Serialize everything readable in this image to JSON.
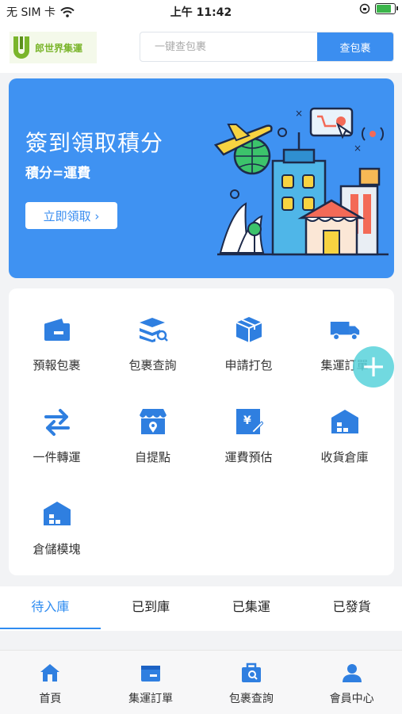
{
  "status": {
    "carrier": "无 SIM 卡",
    "time": "上午 11:42"
  },
  "header": {
    "logo_text": "郎世界集運",
    "search_placeholder": "一键查包裹",
    "search_button": "查包裹"
  },
  "banner": {
    "title": "簽到領取積分",
    "subtitle": "積分=運費",
    "cta": "立即領取 ›"
  },
  "services": [
    {
      "label": "預報包裹",
      "icon": "wallet-icon"
    },
    {
      "label": "包裹查詢",
      "icon": "stack-search-icon"
    },
    {
      "label": "申請打包",
      "icon": "box-icon"
    },
    {
      "label": "集運訂單",
      "icon": "truck-icon"
    },
    {
      "label": "一件轉運",
      "icon": "transfer-arrows-icon"
    },
    {
      "label": "自提點",
      "icon": "store-pin-icon"
    },
    {
      "label": "運費預估",
      "icon": "price-calc-icon"
    },
    {
      "label": "收貨倉庫",
      "icon": "warehouse-icon"
    },
    {
      "label": "倉儲模塊",
      "icon": "storage-icon"
    }
  ],
  "fab": {
    "icon": "plus-icon"
  },
  "tabs": [
    "待入庫",
    "已到庫",
    "已集運",
    "已發貨"
  ],
  "active_tab": "待入庫",
  "bottom_nav": [
    {
      "label": "首頁",
      "icon": "home-icon"
    },
    {
      "label": "集運訂單",
      "icon": "order-icon"
    },
    {
      "label": "包裹查詢",
      "icon": "parcel-search-icon"
    },
    {
      "label": "會員中心",
      "icon": "user-icon"
    }
  ],
  "colors": {
    "primary": "#3b8ef0",
    "banner": "#3f92f2",
    "fab": "#58d2da"
  }
}
